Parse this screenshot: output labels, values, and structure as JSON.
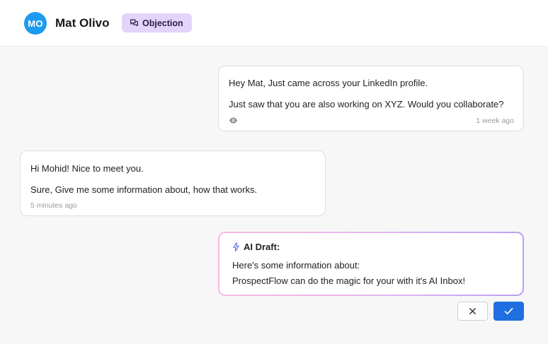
{
  "contact": {
    "initials": "MO",
    "name": "Mat Olivo",
    "tag_label": "Objection",
    "tag_icon": "chat-bubbles-icon"
  },
  "messages": [
    {
      "direction": "outgoing",
      "lines": [
        "Hey Mat, Just came across your LinkedIn profile.",
        "Just saw that you are also working on XYZ.  Would you collaborate?"
      ],
      "status_icon": "eye-icon",
      "time": "1 week ago"
    },
    {
      "direction": "incoming",
      "lines": [
        "Hi Mohid! Nice to meet you.",
        "Sure, Give me some information about, how that works."
      ],
      "time": "5 minutes ago"
    }
  ],
  "draft": {
    "icon": "lightning-icon",
    "label": "AI Draft:",
    "lines": [
      "Here's some information about:",
      "ProspectFlow can do the magic for your with it's AI Inbox!"
    ]
  },
  "actions": {
    "cancel_icon": "close-icon",
    "accept_icon": "check-icon"
  },
  "colors": {
    "avatar": "#1d9bf0",
    "tag_bg": "#e3d4fb",
    "accept": "#1f6fe0",
    "draft_icon": "#5b6cf0"
  }
}
